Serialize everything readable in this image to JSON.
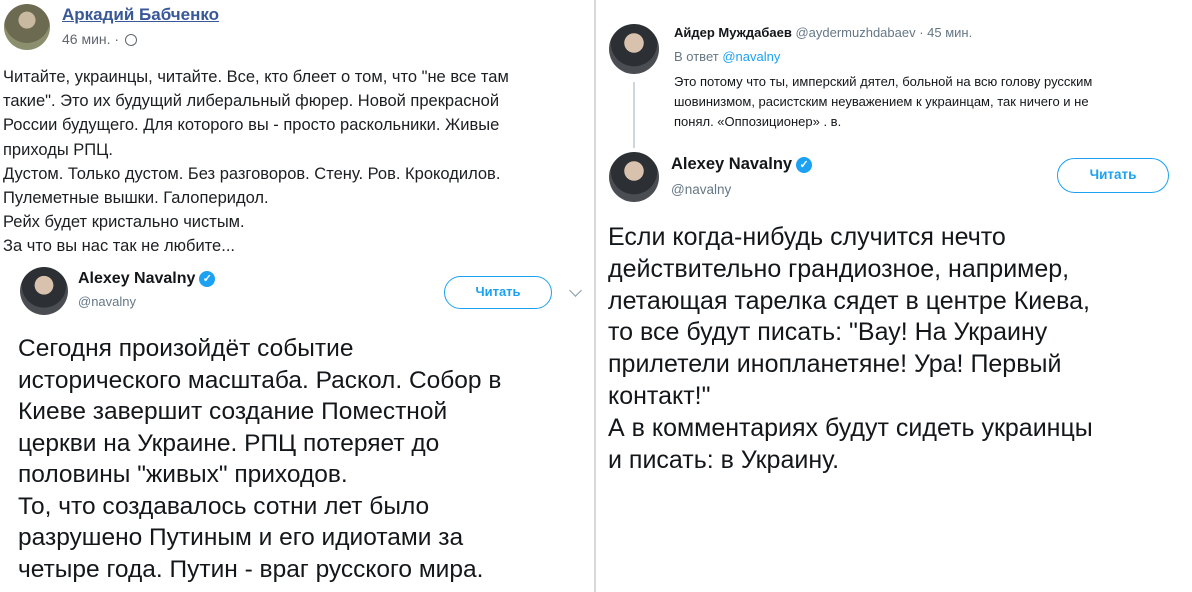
{
  "left": {
    "facebook_post": {
      "author": "Аркадий Бабченко",
      "time": "46 мин. ·",
      "lines": [
        "Читайте, украинцы, читайте. Все, кто блеет о том, что \"не все там",
        "такие\". Это их будущий либеральный фюрер. Новой прекрасной",
        "России будущего. Для которого вы - просто раскольники. Живые",
        "приходы РПЦ.",
        "Дустом. Только дустом. Без разговоров. Стену. Ров. Крокодилов.",
        "Пулеметные вышки. Галоперидол.",
        "Рейх будет кристально чистым.",
        "За что вы нас так не любите..."
      ]
    },
    "embedded_tweet": {
      "name": "Alexey Navalny",
      "handle": "@navalny",
      "follow_label": "Читать",
      "lines": [
        "Сегодня произойдёт событие",
        "исторического масштаба. Раскол. Собор в",
        "Киеве завершит создание Поместной",
        "церкви на Украине. РПЦ потеряет до",
        "половины \"живых\" приходов.",
        "То, что создавалось сотни лет было",
        "разрушено Путиным и его идиотами за",
        "четыре года. Путин - враг русского мира."
      ]
    }
  },
  "right": {
    "reply_tweet": {
      "name": "Айдер Муждабаев",
      "handle": "@aydermuzhdabaev · 45 мин.",
      "reply_prefix": "В ответ",
      "reply_to": "@navalny",
      "lines": [
        "Это потому что ты, имперский дятел, больной на всю голову русским",
        "шовинизмом, расистским неуважением к украинцам, так ничего и не",
        "понял. «Оппозиционер» .     в."
      ]
    },
    "main_tweet": {
      "name": "Alexey Navalny",
      "handle": "@navalny",
      "follow_label": "Читать",
      "lines": [
        "Если когда-нибудь случится нечто",
        "действительно грандиозное, например,",
        "летающая тарелка сядет в центре Киева,",
        "то все будут писать: \"Вау! На Украину",
        "прилетели инопланетяне! Ура! Первый",
        "контакт!\"",
        "А в комментариях будут сидеть украинцы",
        "и писать: в Украину."
      ]
    }
  },
  "icons": {
    "verified": "verified-badge-icon",
    "globe": "globe-icon",
    "chevron": "chevron-down-icon"
  },
  "colors": {
    "facebook_link": "#385898",
    "twitter_blue": "#1da1f2",
    "muted": "#657786"
  }
}
